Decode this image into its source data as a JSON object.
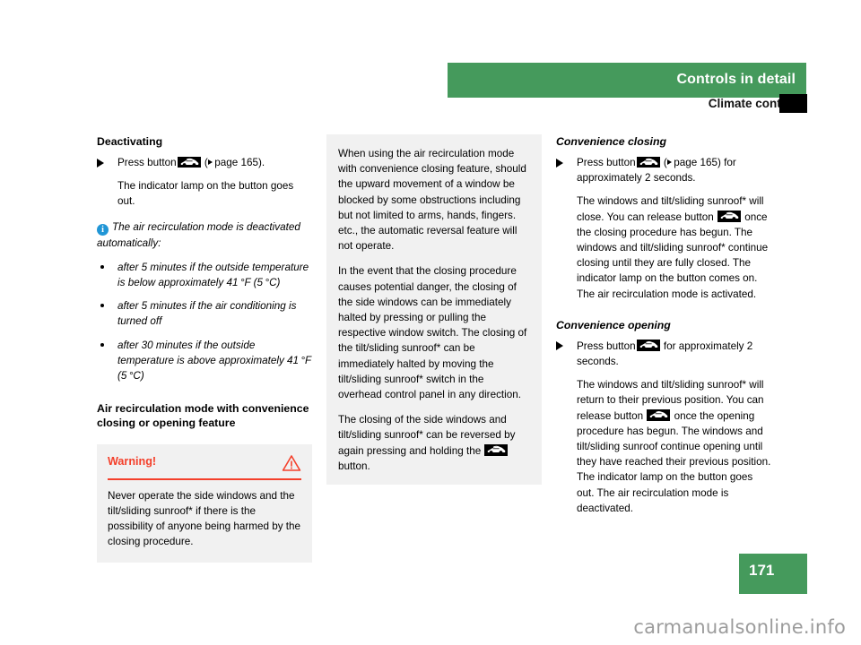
{
  "header": {
    "title": "Controls in detail",
    "subtitle": "Climate control"
  },
  "footer": {
    "page_number": "171",
    "watermark": "carmanualsonline.info"
  },
  "colors": {
    "green": "#459a5c",
    "warning_red": "#f4402b",
    "info_blue": "#2196d6",
    "panel_gray": "#f1f1f1"
  },
  "left_column": {
    "heading": "Deactivating",
    "step1_before": "Press button",
    "step1_after_open": "(",
    "step1_pageref": "page 165).",
    "step1_result": "The indicator lamp on the button goes out.",
    "note_text": "The air recirculation mode is deactivated automatically:",
    "note_bullets": [
      "after 5 minutes if the outside temperature is below approximately 41 °F (5 °C)",
      "after 5 minutes if the air conditioning is turned off",
      "after 30 minutes if the outside temperature is above approximately 41 °F (5 °C)"
    ],
    "heading2": "Air recirculation mode with convenience closing or opening feature",
    "warning": {
      "title": "Warning!",
      "body": "Never operate the side windows and the tilt/sliding sunroof* if there is the possibility of anyone being harmed by the closing procedure."
    }
  },
  "middle_column": {
    "paragraphs": [
      "When using the air recirculation mode with convenience closing feature, should the upward movement of a window be blocked by some obstructions including but not limited to arms, hands, fingers. etc., the automatic reversal feature will not operate.",
      "In the event that the closing procedure causes potential danger, the closing of the side windows can be immediately halted by pressing or pulling the respective window switch. The closing of the tilt/sliding sunroof* can be immediately halted by moving the tilt/sliding sunroof* switch in the overhead control panel in any direction."
    ],
    "last_paragraph_before": "The closing of the side windows and tilt/sliding sunroof* can be reversed by again pressing and holding the",
    "last_paragraph_after": "button."
  },
  "right_column": {
    "heading1": "Convenience closing",
    "step1_before": "Press button",
    "step1_pageref": "page 165) for approximately 2 seconds.",
    "body1_part1": "The windows and tilt/sliding sunroof* will close. You can release button",
    "body1_part2": "once the closing procedure has begun. The windows and tilt/sliding sunroof* continue closing until they are fully closed. The indicator lamp on the button comes on. The air recirculation mode is activated.",
    "heading2": "Convenience opening",
    "step2_before": "Press button",
    "step2_after": "for approximately 2 seconds.",
    "body2_part1": "The windows and tilt/sliding sunroof* will return to their previous position. You can release button",
    "body2_part2": "once the opening procedure has begun. The windows and tilt/sliding sunroof continue opening until they have reached their previous position. The indicator lamp on the button goes out. The air recirculation mode is deactivated."
  },
  "icons": {
    "recirculation_button": "air-recirculation-car-button-icon",
    "fresh_air_button": "fresh-air-car-button-icon",
    "info": "info-icon",
    "warning": "warning-triangle-icon",
    "pageref": "page-reference-triangle-icon"
  }
}
